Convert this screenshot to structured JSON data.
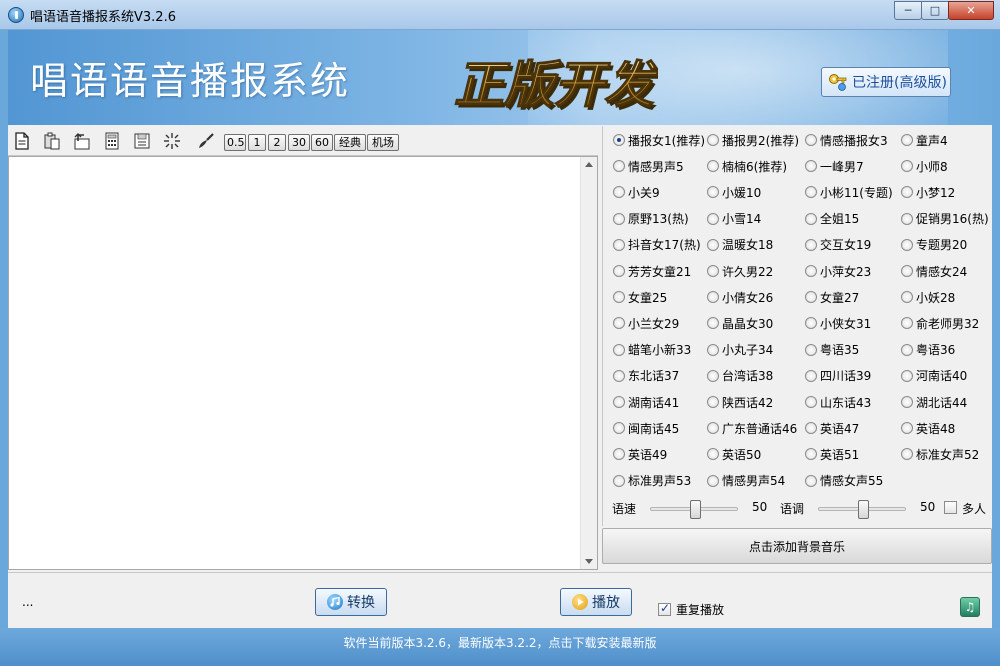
{
  "window": {
    "title": "唱语语音播报系统V3.2.6"
  },
  "header": {
    "app_title": "唱语语音播报系统",
    "logo_text": "正版开发",
    "register_label": "已注册(高级版)"
  },
  "toolbar": {
    "icons": [
      "new-document-icon",
      "paste-icon",
      "undo-icon",
      "calculator-icon",
      "save-icon",
      "sparkle-icon",
      "brush-icon"
    ],
    "speed_buttons": [
      "0.5",
      "1",
      "2",
      "30",
      "60",
      "经典",
      "机场"
    ]
  },
  "editor": {
    "value": ""
  },
  "voices": [
    {
      "label": "播报女1(推荐)",
      "selected": true
    },
    {
      "label": "播报男2(推荐)"
    },
    {
      "label": "情感播报女3"
    },
    {
      "label": "童声4"
    },
    {
      "label": "情感男声5"
    },
    {
      "label": "楠楠6(推荐)"
    },
    {
      "label": "一峰男7"
    },
    {
      "label": "小师8"
    },
    {
      "label": "小关9"
    },
    {
      "label": "小媛10"
    },
    {
      "label": "小彬11(专题)"
    },
    {
      "label": "小梦12"
    },
    {
      "label": "原野13(热)"
    },
    {
      "label": "小雪14"
    },
    {
      "label": "全姐15"
    },
    {
      "label": "促销男16(热)"
    },
    {
      "label": "抖音女17(热)"
    },
    {
      "label": "温暖女18"
    },
    {
      "label": "交互女19"
    },
    {
      "label": "专题男20"
    },
    {
      "label": "芳芳女童21"
    },
    {
      "label": "许久男22"
    },
    {
      "label": "小萍女23"
    },
    {
      "label": "情感女24"
    },
    {
      "label": "女童25"
    },
    {
      "label": "小倩女26"
    },
    {
      "label": "女童27"
    },
    {
      "label": "小妖28"
    },
    {
      "label": "小兰女29"
    },
    {
      "label": "晶晶女30"
    },
    {
      "label": "小侠女31"
    },
    {
      "label": "俞老师男32"
    },
    {
      "label": "蜡笔小新33"
    },
    {
      "label": "小丸子34"
    },
    {
      "label": "粤语35"
    },
    {
      "label": "粤语36"
    },
    {
      "label": "东北话37"
    },
    {
      "label": "台湾话38"
    },
    {
      "label": "四川话39"
    },
    {
      "label": "河南话40"
    },
    {
      "label": "湖南话41"
    },
    {
      "label": "陕西话42"
    },
    {
      "label": "山东话43"
    },
    {
      "label": "湖北话44"
    },
    {
      "label": "闽南话45"
    },
    {
      "label": "广东普通话46"
    },
    {
      "label": "英语47"
    },
    {
      "label": "英语48"
    },
    {
      "label": "英语49"
    },
    {
      "label": "英语50"
    },
    {
      "label": "英语51"
    },
    {
      "label": "标准女声52"
    },
    {
      "label": "标准男声53"
    },
    {
      "label": "情感男声54"
    },
    {
      "label": "情感女声55"
    }
  ],
  "controls": {
    "speed_label": "语速",
    "speed_value": "50",
    "speed_level": 0.5,
    "pitch_label": "语调",
    "pitch_value": "50",
    "pitch_level": 0.5,
    "multi_label": "多人",
    "multi_checked": false
  },
  "bgm_button": "点击添加背景音乐",
  "bottom": {
    "status": "...",
    "convert_label": "转换",
    "play_label": "播放",
    "repeat_label": "重复播放",
    "repeat_checked": true
  },
  "footer": {
    "text": "软件当前版本3.2.6，最新版本3.2.2，点击下载安装最新版"
  },
  "colors": {
    "accent": "#1d4f9c",
    "banner": "#6aa7da",
    "footer": "#5b99d3"
  }
}
